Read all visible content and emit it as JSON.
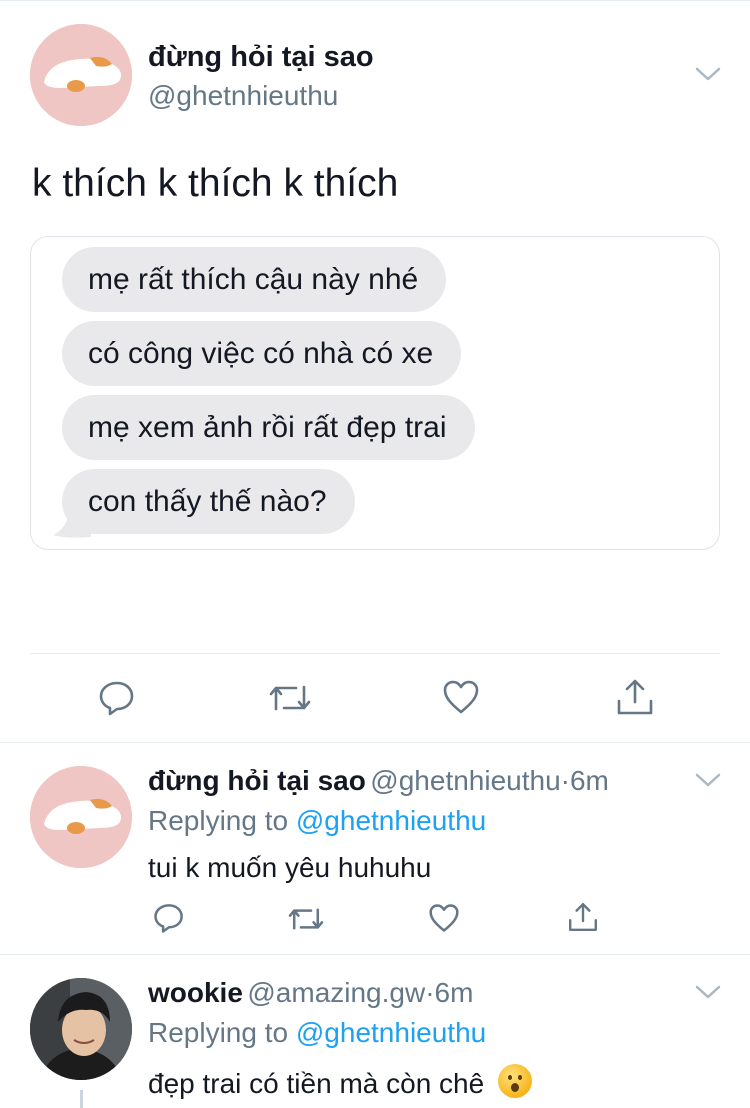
{
  "main_tweet": {
    "author_name": "đừng hỏi tại sao",
    "author_handle": "@ghetnhieuthu",
    "text": "k thích k thích k thích",
    "media_messages": [
      "mẹ rất thích cậu này nhé",
      "có công việc có nhà có xe",
      "mẹ xem ảnh rồi rất đẹp trai",
      "con thấy thế nào?"
    ]
  },
  "replies": [
    {
      "author_name": "đừng hỏi tại sao",
      "author_handle": "@ghetnhieuthu",
      "dot": "·",
      "time": "6m",
      "replying_prefix": "Replying to",
      "replying_to": "@ghetnhieuthu",
      "text": "tui k muốn yêu huhuhu"
    },
    {
      "author_name": "wookie",
      "author_handle": "@amazing.gw",
      "dot": "·",
      "time": "6m",
      "replying_prefix": "Replying to",
      "replying_to": "@ghetnhieuthu",
      "text": "đẹp trai có tiền mà còn chê",
      "emoji": "hushed-face-emoji"
    }
  ],
  "icons": {
    "reply": "reply-icon",
    "retweet": "retweet-icon",
    "like": "heart-icon",
    "share": "share-icon",
    "menu": "chevron-down-icon"
  },
  "colors": {
    "text": "#141823",
    "secondary": "#657786",
    "link": "#1da1f2",
    "bubble": "#e9e9eb",
    "divider": "#e6ecf0"
  }
}
